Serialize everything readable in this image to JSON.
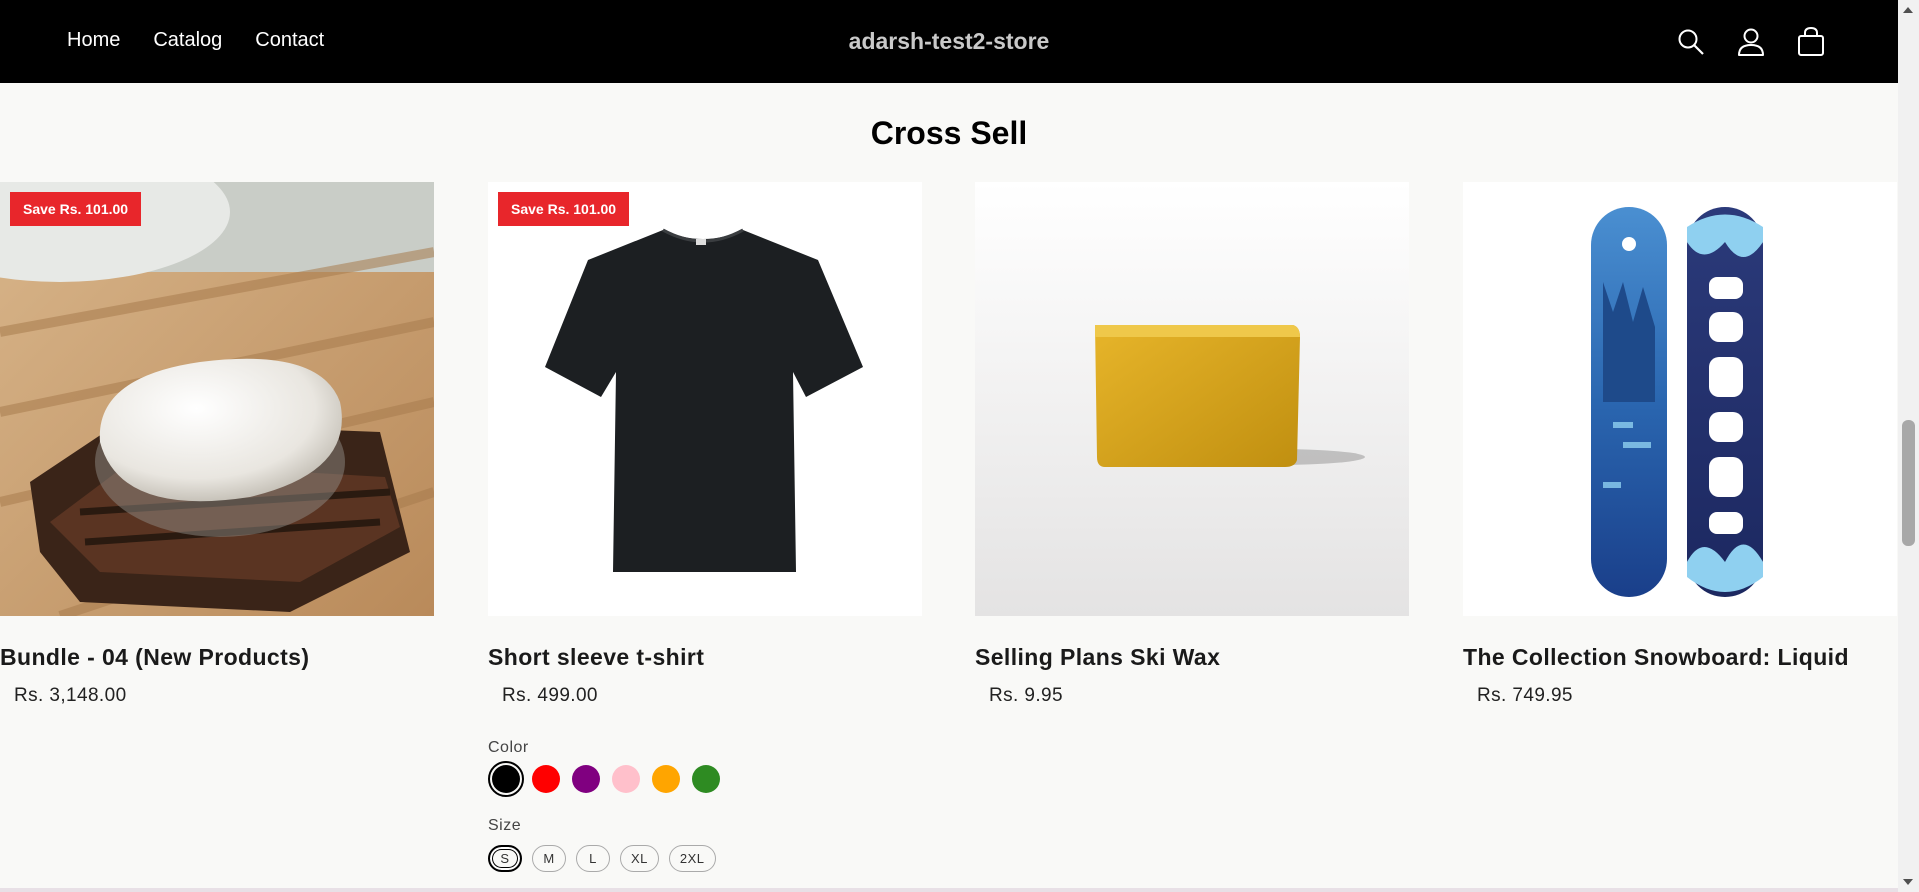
{
  "header": {
    "nav": [
      "Home",
      "Catalog",
      "Contact"
    ],
    "brand": "adarsh-test2-store",
    "icons": [
      "search-icon",
      "account-icon",
      "cart-icon"
    ]
  },
  "section": {
    "title": "Cross Sell"
  },
  "products": [
    {
      "title": "Bundle - 04 (New Products)",
      "price": "Rs. 3,148.00",
      "badge": "Save Rs. 101.00"
    },
    {
      "title": "Short sleeve t-shirt",
      "price": "Rs. 499.00",
      "badge": "Save Rs. 101.00"
    },
    {
      "title": "Selling Plans Ski Wax",
      "price": "Rs. 9.95"
    },
    {
      "title": "The Collection Snowboard: Liquid",
      "price": "Rs. 749.95"
    }
  ],
  "options": {
    "color_label": "Color",
    "colors": [
      "#000000",
      "#ff0000",
      "#800080",
      "#ffc0cb",
      "#ffa500",
      "#2e8b22"
    ],
    "selected_color": "#000000",
    "size_label": "Size",
    "sizes": [
      "S",
      "M",
      "L",
      "XL",
      "2XL"
    ],
    "selected_size": "S"
  },
  "colors": {
    "header_bg": "#000000",
    "badge": "#e8262b",
    "page_bg": "#f9f9f7"
  }
}
